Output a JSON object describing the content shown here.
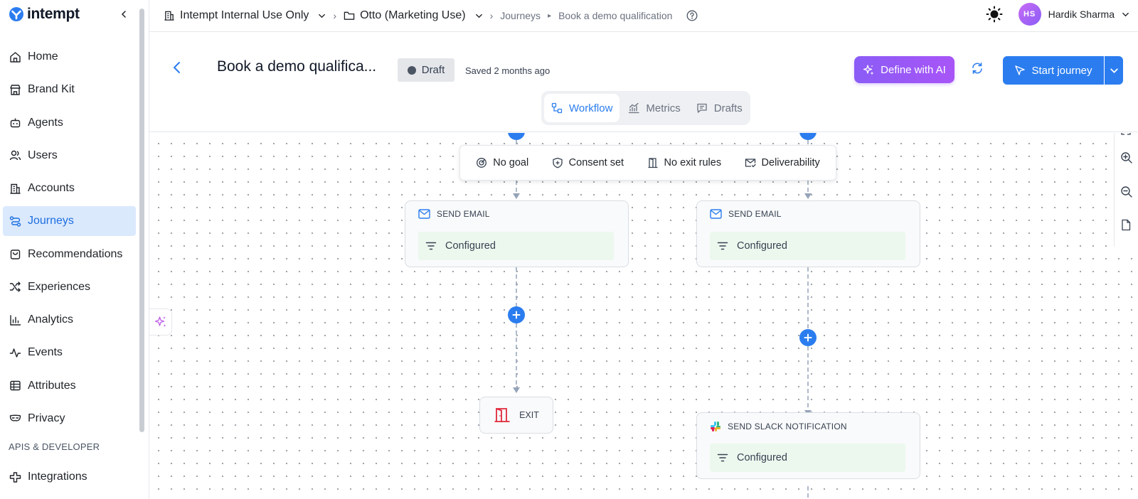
{
  "brand": {
    "name": "intempt"
  },
  "sidebar": {
    "items": [
      {
        "label": "Home",
        "icon": "home-icon",
        "active": false
      },
      {
        "label": "Brand Kit",
        "icon": "store-icon",
        "active": false
      },
      {
        "label": "Agents",
        "icon": "bot-icon",
        "active": false
      },
      {
        "label": "Users",
        "icon": "users-icon",
        "active": false
      },
      {
        "label": "Accounts",
        "icon": "building-icon",
        "active": false
      },
      {
        "label": "Journeys",
        "icon": "route-icon",
        "active": true
      },
      {
        "label": "Recommendations",
        "icon": "bag-icon",
        "active": false
      },
      {
        "label": "Experiences",
        "icon": "shuffle-icon",
        "active": false
      },
      {
        "label": "Analytics",
        "icon": "bar-chart-icon",
        "active": false
      },
      {
        "label": "Events",
        "icon": "activity-icon",
        "active": false
      },
      {
        "label": "Attributes",
        "icon": "table-icon",
        "active": false
      },
      {
        "label": "Privacy",
        "icon": "mask-icon",
        "active": false
      }
    ],
    "section": "APIS & DEVELOPER",
    "section_items": [
      {
        "label": "Integrations",
        "icon": "integrations-icon"
      }
    ]
  },
  "topbar": {
    "org": "Intempt Internal Use Only",
    "project": "Otto (Marketing Use)",
    "section": "Journeys",
    "page": "Book a demo qualification",
    "user_initials": "HS",
    "user_name": "Hardik Sharma"
  },
  "journey": {
    "title": "Book a demo qualifica...",
    "status": "Draft",
    "saved": "Saved 2 months ago",
    "ai_label": "Define with AI",
    "start_label": "Start journey",
    "tabs": [
      {
        "label": "Workflow",
        "active": true
      },
      {
        "label": "Metrics",
        "active": false
      },
      {
        "label": "Drafts",
        "active": false
      }
    ]
  },
  "goalbar": {
    "goal": "No goal",
    "consent": "Consent set",
    "exit_rules": "No exit rules",
    "deliverability": "Deliverability"
  },
  "nodes": {
    "email_left": {
      "type": "SEND EMAIL",
      "status": "Configured"
    },
    "email_right": {
      "type": "SEND EMAIL",
      "status": "Configured"
    },
    "exit": {
      "label": "EXIT"
    },
    "slack": {
      "type": "SEND SLACK NOTIFICATION",
      "status": "Configured"
    }
  },
  "colors": {
    "accent": "#2b7def",
    "active_bg": "#dbe9fd",
    "ai_gradient_start": "#8b5cf6",
    "configured_bg": "#ecf8ee",
    "exit_red": "#e0293b"
  }
}
